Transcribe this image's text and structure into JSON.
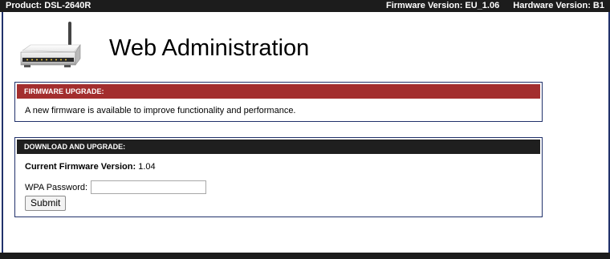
{
  "topbar": {
    "product": "Product: DSL-2640R",
    "firmware_version": "Firmware Version: EU_1.06",
    "hardware_version": "Hardware Version: B1"
  },
  "header": {
    "logo_icon": "router-icon",
    "title": "Web Administration"
  },
  "firmware_panel": {
    "title": "FIRMWARE UPGRADE:",
    "message": "A new firmware is available to improve functionality and performance.",
    "header_color": "#a32e2e"
  },
  "download_panel": {
    "title": "DOWNLOAD AND UPGRADE:",
    "current_label": "Current Firmware Version:",
    "current_value": "1.04",
    "password_label": "WPA Password:",
    "password_value": "",
    "submit_label": "Submit",
    "header_color": "#1f1f1f"
  },
  "colors": {
    "topbar": "#1c1c1c",
    "border": "#21326b"
  }
}
